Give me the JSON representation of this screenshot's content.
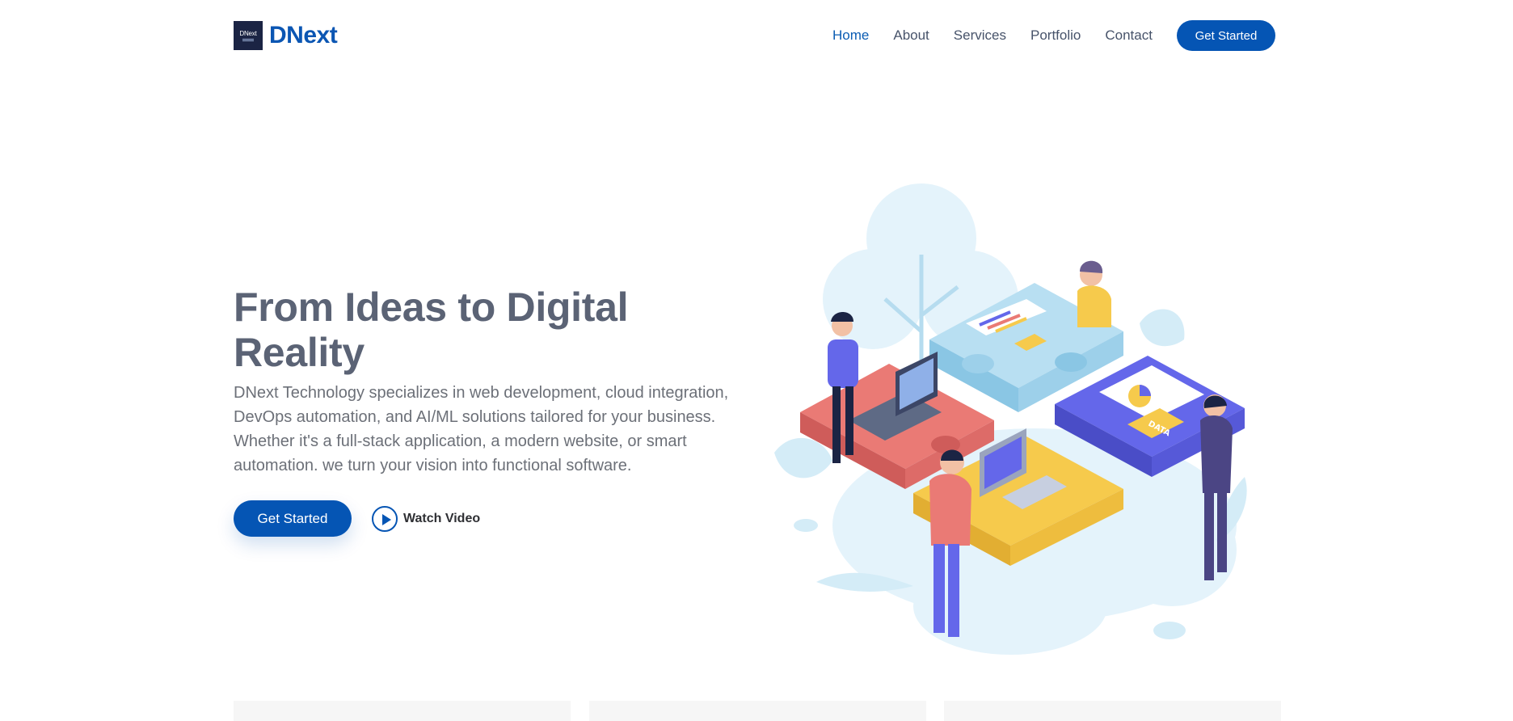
{
  "header": {
    "logo_mark_text": "DNext",
    "logo_text": "DNext",
    "nav": [
      {
        "label": "Home",
        "active": true
      },
      {
        "label": "About"
      },
      {
        "label": "Services"
      },
      {
        "label": "Portfolio"
      },
      {
        "label": "Contact"
      }
    ],
    "cta_label": "Get Started"
  },
  "hero": {
    "title": "From Ideas to Digital Reality",
    "description": "DNext Technology specializes in web development, cloud integration, DevOps automation, and AI/ML solutions tailored for your business. Whether it's a full-stack application, a modern website, or smart automation. we turn your vision into functional software.",
    "primary_button": "Get Started",
    "video_button": "Watch Video",
    "illustration": {
      "data_tag": "DATA"
    }
  },
  "colors": {
    "brand": "#0555b4",
    "title": "#5b6375",
    "body_text": "#6c7078",
    "puzzle_red": "#ea7a75",
    "puzzle_yellow": "#f6ca4c",
    "puzzle_blue": "#b8dff2",
    "puzzle_purple": "#6467ea",
    "illustration_bg": "#e4f3fb"
  }
}
